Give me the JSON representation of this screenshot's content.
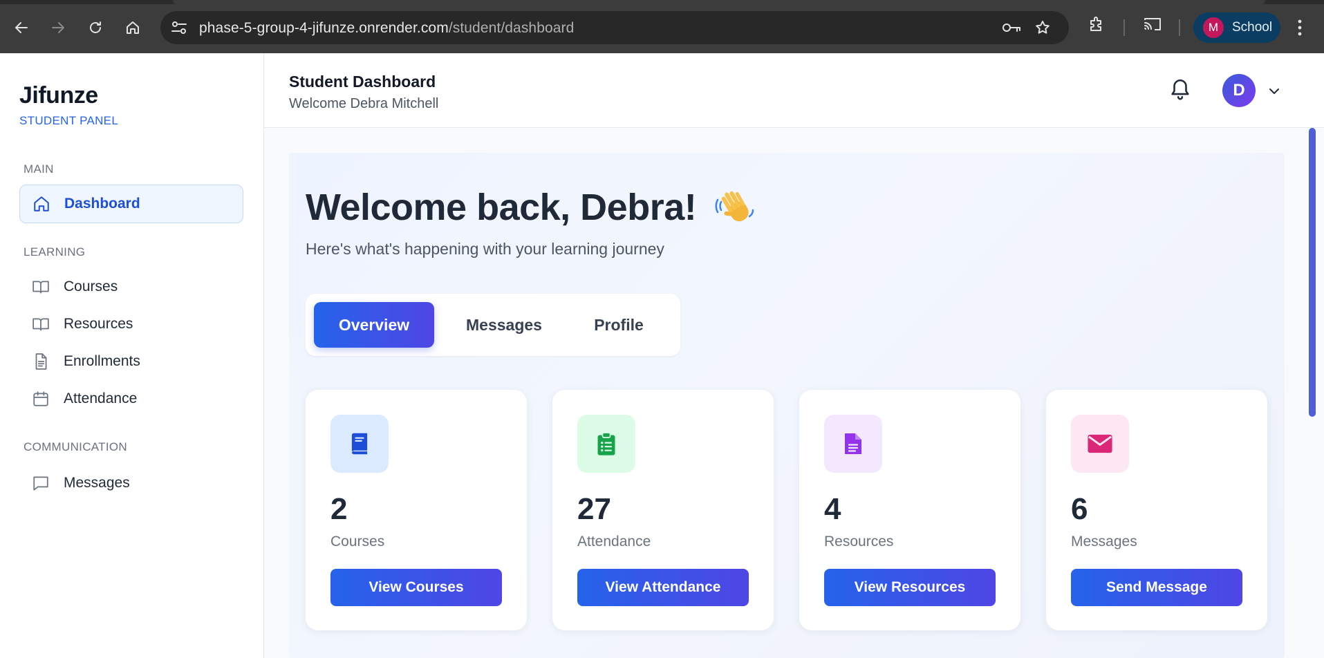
{
  "browser": {
    "url_host": "phase-5-group-4-jifunze.onrender.com",
    "url_path": "/student/dashboard",
    "profile_initial": "M",
    "profile_label": "School"
  },
  "sidebar": {
    "brand": "Jifunze",
    "brand_sub": "STUDENT PANEL",
    "sections": [
      {
        "label": "MAIN"
      },
      {
        "label": "LEARNING"
      },
      {
        "label": "COMMUNICATION"
      }
    ],
    "items": [
      {
        "label": "Dashboard",
        "icon": "home-icon",
        "active": true
      },
      {
        "label": "Courses",
        "icon": "book-open-icon"
      },
      {
        "label": "Resources",
        "icon": "book-open-icon"
      },
      {
        "label": "Enrollments",
        "icon": "document-icon"
      },
      {
        "label": "Attendance",
        "icon": "calendar-icon"
      },
      {
        "label": "Messages",
        "icon": "chat-icon"
      }
    ]
  },
  "header": {
    "title": "Student Dashboard",
    "subtitle": "Welcome Debra Mitchell",
    "avatar_initial": "D"
  },
  "main": {
    "welcome": "Welcome back, Debra!",
    "welcome_sub": "Here's what's happening with your learning journey",
    "tabs": [
      {
        "label": "Overview",
        "active": true
      },
      {
        "label": "Messages"
      },
      {
        "label": "Profile"
      }
    ],
    "cards": [
      {
        "value": "2",
        "label": "Courses",
        "button": "View Courses",
        "icon": "book-icon",
        "icon_color": "#1d4ed8",
        "icon_bg": "#dbeafe"
      },
      {
        "value": "27",
        "label": "Attendance",
        "button": "View Attendance",
        "icon": "clipboard-list-icon",
        "icon_color": "#16a34a",
        "icon_bg": "#dcfce7"
      },
      {
        "value": "4",
        "label": "Resources",
        "button": "View Resources",
        "icon": "file-icon",
        "icon_color": "#9333ea",
        "icon_bg": "#f3e8ff"
      },
      {
        "value": "6",
        "label": "Messages",
        "button": "Send Message",
        "icon": "envelope-icon",
        "icon_color": "#db2777",
        "icon_bg": "#fce7f3"
      }
    ]
  },
  "colors": {
    "accent": "#2563eb",
    "accent_end": "#4f46e5"
  }
}
